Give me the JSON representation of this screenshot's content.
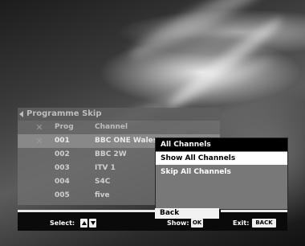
{
  "panel": {
    "title": "Programme Skip",
    "columns": {
      "skip": "✕",
      "prog": "Prog",
      "channel": "Channel"
    },
    "rows": [
      {
        "skip": "✕",
        "prog": "001",
        "channel": "BBC ONE Wales"
      },
      {
        "skip": "",
        "prog": "002",
        "channel": "BBC 2W"
      },
      {
        "skip": "",
        "prog": "003",
        "channel": "ITV 1"
      },
      {
        "skip": "",
        "prog": "004",
        "channel": "S4C"
      },
      {
        "skip": "",
        "prog": "005",
        "channel": "five"
      }
    ]
  },
  "popup": {
    "options": [
      "All Channels",
      "Show All Channels",
      "Skip All Channels"
    ],
    "back": "Back"
  },
  "footer": {
    "select_label": "Select:",
    "show_label": "Show:",
    "show_key": "OK",
    "exit_label": "Exit:",
    "exit_key": "BACK"
  }
}
